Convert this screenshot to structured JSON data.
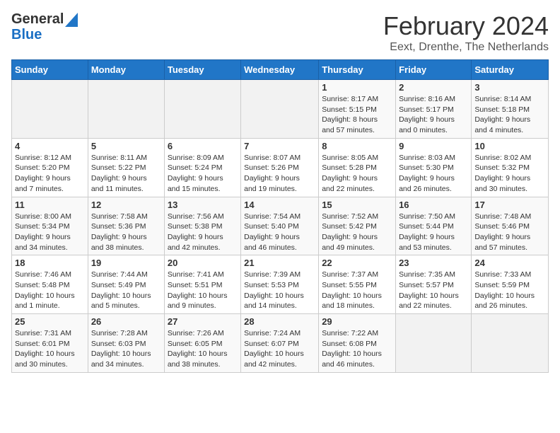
{
  "header": {
    "logo": {
      "general": "General",
      "blue": "Blue"
    },
    "month": "February 2024",
    "location": "Eext, Drenthe, The Netherlands"
  },
  "weekdays": [
    "Sunday",
    "Monday",
    "Tuesday",
    "Wednesday",
    "Thursday",
    "Friday",
    "Saturday"
  ],
  "weeks": [
    [
      {
        "day": "",
        "info": ""
      },
      {
        "day": "",
        "info": ""
      },
      {
        "day": "",
        "info": ""
      },
      {
        "day": "",
        "info": ""
      },
      {
        "day": "1",
        "info": "Sunrise: 8:17 AM\nSunset: 5:15 PM\nDaylight: 8 hours\nand 57 minutes."
      },
      {
        "day": "2",
        "info": "Sunrise: 8:16 AM\nSunset: 5:17 PM\nDaylight: 9 hours\nand 0 minutes."
      },
      {
        "day": "3",
        "info": "Sunrise: 8:14 AM\nSunset: 5:18 PM\nDaylight: 9 hours\nand 4 minutes."
      }
    ],
    [
      {
        "day": "4",
        "info": "Sunrise: 8:12 AM\nSunset: 5:20 PM\nDaylight: 9 hours\nand 7 minutes."
      },
      {
        "day": "5",
        "info": "Sunrise: 8:11 AM\nSunset: 5:22 PM\nDaylight: 9 hours\nand 11 minutes."
      },
      {
        "day": "6",
        "info": "Sunrise: 8:09 AM\nSunset: 5:24 PM\nDaylight: 9 hours\nand 15 minutes."
      },
      {
        "day": "7",
        "info": "Sunrise: 8:07 AM\nSunset: 5:26 PM\nDaylight: 9 hours\nand 19 minutes."
      },
      {
        "day": "8",
        "info": "Sunrise: 8:05 AM\nSunset: 5:28 PM\nDaylight: 9 hours\nand 22 minutes."
      },
      {
        "day": "9",
        "info": "Sunrise: 8:03 AM\nSunset: 5:30 PM\nDaylight: 9 hours\nand 26 minutes."
      },
      {
        "day": "10",
        "info": "Sunrise: 8:02 AM\nSunset: 5:32 PM\nDaylight: 9 hours\nand 30 minutes."
      }
    ],
    [
      {
        "day": "11",
        "info": "Sunrise: 8:00 AM\nSunset: 5:34 PM\nDaylight: 9 hours\nand 34 minutes."
      },
      {
        "day": "12",
        "info": "Sunrise: 7:58 AM\nSunset: 5:36 PM\nDaylight: 9 hours\nand 38 minutes."
      },
      {
        "day": "13",
        "info": "Sunrise: 7:56 AM\nSunset: 5:38 PM\nDaylight: 9 hours\nand 42 minutes."
      },
      {
        "day": "14",
        "info": "Sunrise: 7:54 AM\nSunset: 5:40 PM\nDaylight: 9 hours\nand 46 minutes."
      },
      {
        "day": "15",
        "info": "Sunrise: 7:52 AM\nSunset: 5:42 PM\nDaylight: 9 hours\nand 49 minutes."
      },
      {
        "day": "16",
        "info": "Sunrise: 7:50 AM\nSunset: 5:44 PM\nDaylight: 9 hours\nand 53 minutes."
      },
      {
        "day": "17",
        "info": "Sunrise: 7:48 AM\nSunset: 5:46 PM\nDaylight: 9 hours\nand 57 minutes."
      }
    ],
    [
      {
        "day": "18",
        "info": "Sunrise: 7:46 AM\nSunset: 5:48 PM\nDaylight: 10 hours\nand 1 minute."
      },
      {
        "day": "19",
        "info": "Sunrise: 7:44 AM\nSunset: 5:49 PM\nDaylight: 10 hours\nand 5 minutes."
      },
      {
        "day": "20",
        "info": "Sunrise: 7:41 AM\nSunset: 5:51 PM\nDaylight: 10 hours\nand 9 minutes."
      },
      {
        "day": "21",
        "info": "Sunrise: 7:39 AM\nSunset: 5:53 PM\nDaylight: 10 hours\nand 14 minutes."
      },
      {
        "day": "22",
        "info": "Sunrise: 7:37 AM\nSunset: 5:55 PM\nDaylight: 10 hours\nand 18 minutes."
      },
      {
        "day": "23",
        "info": "Sunrise: 7:35 AM\nSunset: 5:57 PM\nDaylight: 10 hours\nand 22 minutes."
      },
      {
        "day": "24",
        "info": "Sunrise: 7:33 AM\nSunset: 5:59 PM\nDaylight: 10 hours\nand 26 minutes."
      }
    ],
    [
      {
        "day": "25",
        "info": "Sunrise: 7:31 AM\nSunset: 6:01 PM\nDaylight: 10 hours\nand 30 minutes."
      },
      {
        "day": "26",
        "info": "Sunrise: 7:28 AM\nSunset: 6:03 PM\nDaylight: 10 hours\nand 34 minutes."
      },
      {
        "day": "27",
        "info": "Sunrise: 7:26 AM\nSunset: 6:05 PM\nDaylight: 10 hours\nand 38 minutes."
      },
      {
        "day": "28",
        "info": "Sunrise: 7:24 AM\nSunset: 6:07 PM\nDaylight: 10 hours\nand 42 minutes."
      },
      {
        "day": "29",
        "info": "Sunrise: 7:22 AM\nSunset: 6:08 PM\nDaylight: 10 hours\nand 46 minutes."
      },
      {
        "day": "",
        "info": ""
      },
      {
        "day": "",
        "info": ""
      }
    ]
  ]
}
